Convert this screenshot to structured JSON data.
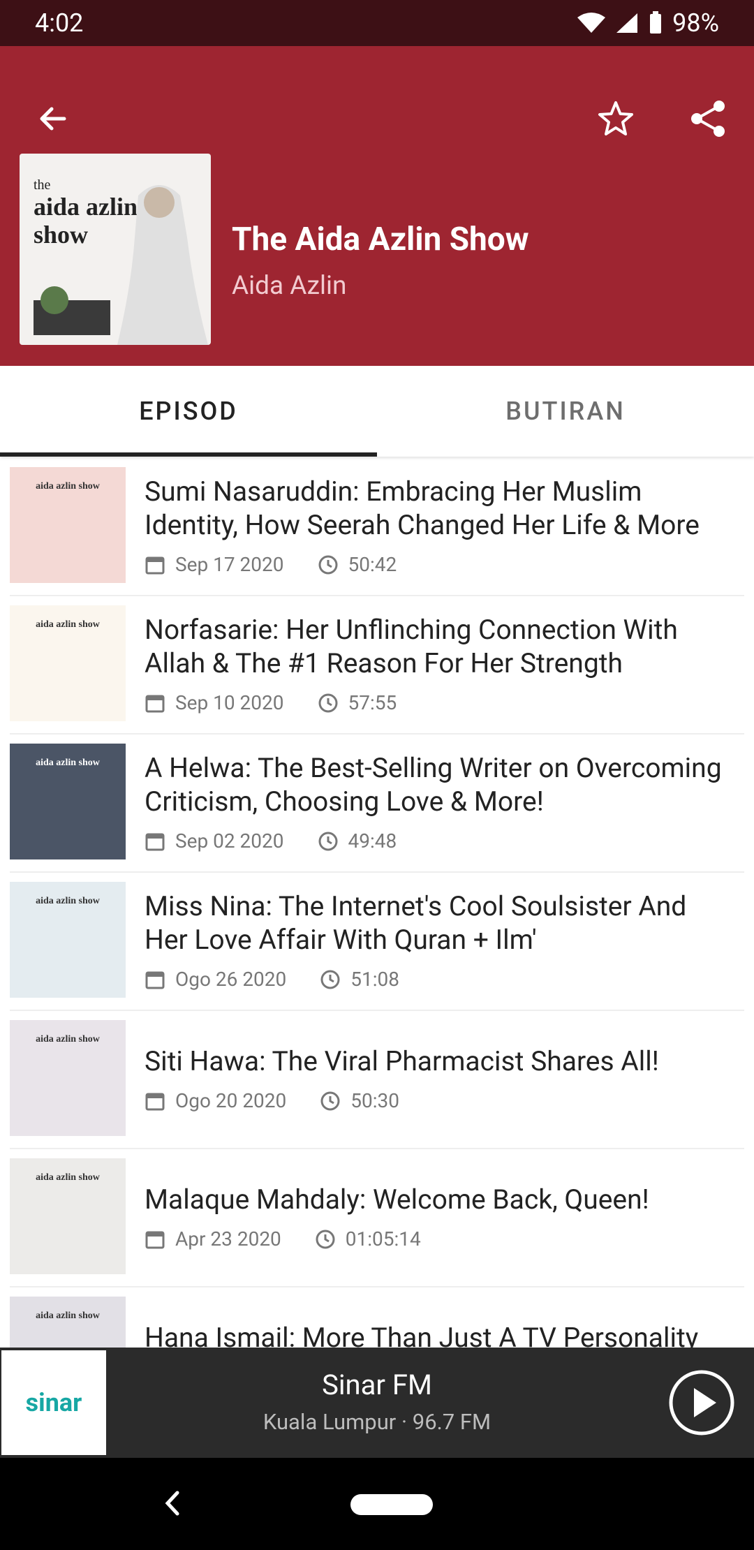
{
  "status": {
    "time": "4:02",
    "battery": "98%"
  },
  "header": {
    "show_title": "The Aida Azlin Show",
    "show_author": "Aida Azlin",
    "cover_art_text": {
      "small": "the",
      "main": "aida azlin show"
    }
  },
  "tabs": [
    {
      "label": "EPISOD",
      "active": true
    },
    {
      "label": "BUTIRAN",
      "active": false
    }
  ],
  "episodes": [
    {
      "title": "Sumi Nasaruddin: Embracing Her Muslim Identity, How Seerah Changed Her Life & More",
      "date": "Sep 17 2020",
      "duration": "50:42",
      "thumb_text": "aida azlin show"
    },
    {
      "title": "Norfasarie: Her Unflinching Connection With Allah & The #1 Reason For Her Strength",
      "date": "Sep 10 2020",
      "duration": "57:55",
      "thumb_text": "aida azlin show"
    },
    {
      "title": "A Helwa: The Best-Selling Writer on Overcoming Criticism, Choosing Love & More!",
      "date": "Sep 02 2020",
      "duration": "49:48",
      "thumb_text": "aida azlin show"
    },
    {
      "title": "Miss Nina: The Internet's Cool Soulsister And Her Love Affair With Quran + Ilm'",
      "date": "Ogo 26 2020",
      "duration": "51:08",
      "thumb_text": "aida azlin show"
    },
    {
      "title": "Siti Hawa: The Viral Pharmacist Shares All!",
      "date": "Ogo 20 2020",
      "duration": "50:30",
      "thumb_text": "aida azlin show"
    },
    {
      "title": "Malaque Mahdaly: Welcome Back, Queen!",
      "date": "Apr 23 2020",
      "duration": "01:05:14",
      "thumb_text": "aida azlin show"
    },
    {
      "title": "Hana Ismail: More Than Just A TV Personality",
      "date": "",
      "duration": "",
      "thumb_text": "aida azlin show"
    }
  ],
  "player": {
    "station_logo_text": "sinar",
    "station_name": "Sinar FM",
    "station_sub": "Kuala Lumpur · 96.7 FM"
  },
  "colors": {
    "header": "#9e2531",
    "statusbar": "#3d1015",
    "player": "#2b2b2b"
  },
  "icons": [
    "back-arrow-icon",
    "star-icon",
    "share-icon",
    "calendar-icon",
    "clock-icon",
    "play-icon"
  ]
}
